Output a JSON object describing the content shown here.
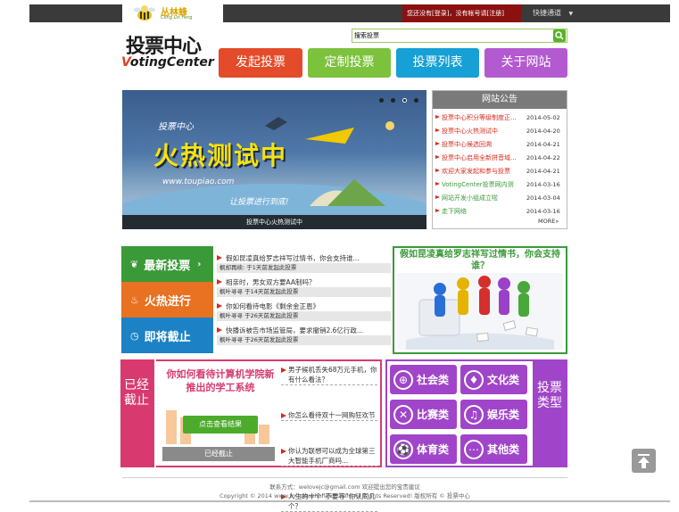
{
  "header": {
    "brand_cn": "丛林蜂",
    "brand_en": "Cong Lin Feng",
    "login_prefix": "您还没有",
    "login_link": "[登录]",
    "login_mid": "，没有帐号请",
    "register_link": "[注册]",
    "quick_nav": "快捷通道"
  },
  "logo": {
    "main": "投票中心",
    "en_v": "V",
    "en_rest": "otingCenter"
  },
  "search": {
    "value": "搜索投票"
  },
  "nav": {
    "items": [
      "发起投票",
      "定制投票",
      "投票列表",
      "关于网站"
    ]
  },
  "banner": {
    "small": "投票中心",
    "headline": "火热测试中",
    "url": "www.toupiao.com",
    "slogan": "让投票进行到底!",
    "caption": "投票中心火热测试中"
  },
  "board": {
    "title": "网站公告",
    "items": [
      {
        "title": "投票中心积分等级制度正...",
        "date": "2014-05-02",
        "color": "#d82b1b"
      },
      {
        "title": "投票中心火热测试中",
        "date": "2014-04-20",
        "color": "#d82b1b"
      },
      {
        "title": "投票中心候选回溯",
        "date": "2014-04-21",
        "color": "#d82b1b"
      },
      {
        "title": "投票中心启用全新拼音域...",
        "date": "2014-04-22",
        "color": "#d82b1b"
      },
      {
        "title": "欢迎大家发起和参与投票",
        "date": "2014-04-21",
        "color": "#d82b1b"
      },
      {
        "title": "VotingCenter投票网内测",
        "date": "2014-03-16",
        "color": "#3a9a38"
      },
      {
        "title": "网站开发小组成立啦",
        "date": "2014-03-04",
        "color": "#3a9a38"
      },
      {
        "title": "走下网络",
        "date": "2014-03-16",
        "color": "#3a9a38"
      }
    ],
    "more": "MORE»"
  },
  "categories": [
    "最新投票",
    "火热进行",
    "即将截止"
  ],
  "votes": [
    {
      "title": "假如昆凌真给罗志祥写过情书，你会支持谁...",
      "meta": "枫却再续: 于1天前发起此投票"
    },
    {
      "title": "相亲时，男女双方要AA制吗？",
      "meta": "枫叶寻寻 于14天前发起此投票"
    },
    {
      "title": "你如何看待电影《剩余金正恩》",
      "meta": "枫叶寻寻 于26天前发起此投票"
    },
    {
      "title": "快播诉被告市场监管局，要求撤销2.6亿行政...",
      "meta": "枫叶寻寻 于26天前发起此投票"
    }
  ],
  "feature": {
    "title": "假如昆凌真给罗志祥写过情书，你会支持谁？"
  },
  "ended": {
    "label": "已经截止",
    "title": "你如何看待计算机学院新推出的学工系统",
    "result_button": "点击查看结果",
    "badge": "已经截止",
    "items": [
      "男子候机丢失68万元手机，你有什么看法？",
      "你怎么看待双十一网购狂欢节",
      "你认为联想可以成为全球第三大智能手机厂商吗...",
      "人生的十个“不要等”你认同几个？"
    ]
  },
  "types": {
    "label": "投票类型",
    "items": [
      {
        "label": "社会类",
        "icon": "globe-icon",
        "glyph": "⊕"
      },
      {
        "label": "文化类",
        "icon": "culture-icon",
        "glyph": "♦"
      },
      {
        "label": "比赛类",
        "icon": "versus-icon",
        "glyph": "✕"
      },
      {
        "label": "娱乐类",
        "icon": "music-icon",
        "glyph": "♫"
      },
      {
        "label": "体育类",
        "icon": "sport-icon",
        "glyph": "⚽"
      },
      {
        "label": "其他类",
        "icon": "more-icon",
        "glyph": "⋯"
      }
    ]
  },
  "footer": {
    "contact": "联系方式：welovejc@gmail.com    欢迎提出您的宝贵建议",
    "copyright": "Copyright © 2014 www.toupiaozhongxin.com All Rights Reserved! 版权所有 © 投票中心"
  },
  "colors": {
    "green": "#3a9a38",
    "orange": "#e87122",
    "blue": "#1c82c5",
    "pink": "#d83a6f",
    "purple": "#a045c9",
    "red": "#d82b1b"
  }
}
